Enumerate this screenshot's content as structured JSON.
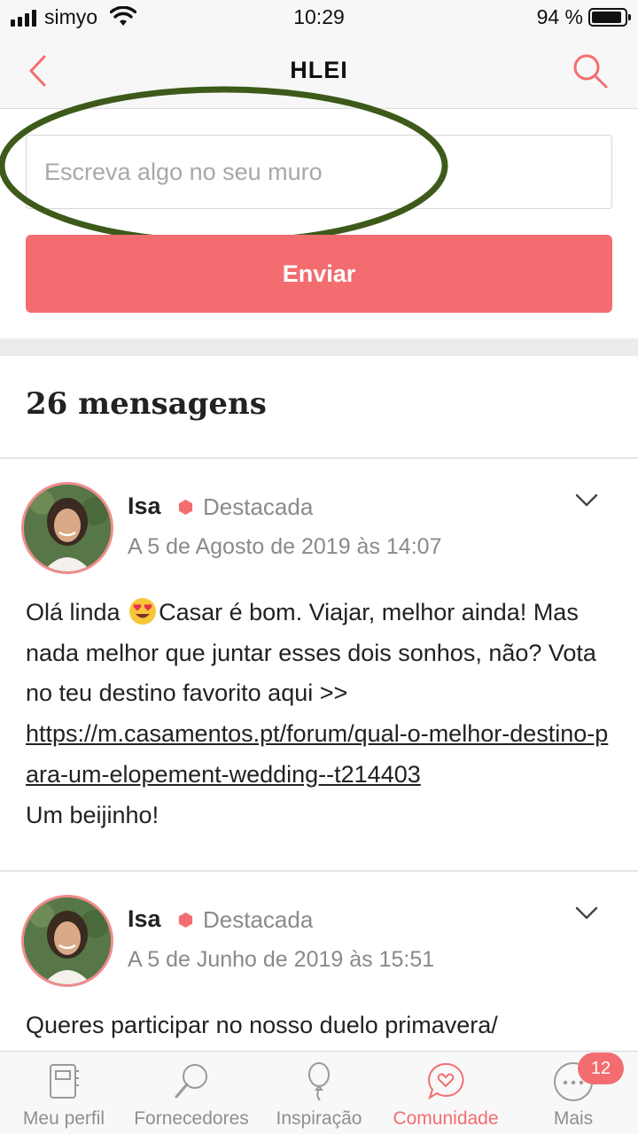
{
  "status_bar": {
    "carrier": "simyo",
    "time": "10:29",
    "battery": "94 %"
  },
  "header": {
    "title": "HLEI",
    "back_icon": "chevron-left-icon",
    "search_icon": "search-icon"
  },
  "composer": {
    "placeholder": "Escreva algo no seu muro",
    "send_label": "Enviar"
  },
  "messages": {
    "count_label": "26 mensagens",
    "posts": [
      {
        "author": "Isa",
        "badge": "Destacada",
        "date": "A 5 de Agosto de 2019 às 14:07",
        "text_before_emoji": "Olá linda",
        "text_after_emoji": "Casar é bom. Viajar, melhor ainda! Mas nada melhor que juntar esses dois sonhos, não? Vota no teu destino favorito aqui >>",
        "link": "https://m.casamentos.pt/forum/qual-o-melhor-destino-para-um-elopement-wedding--t214403",
        "closing": "Um beijinho!"
      },
      {
        "author": "Isa",
        "badge": "Destacada",
        "date": "A 5 de Junho de 2019 às 15:51",
        "text": "Queres participar no nosso duelo primavera/"
      }
    ]
  },
  "tab_bar": {
    "items": [
      {
        "label": "Meu perfil",
        "icon": "notebook-icon"
      },
      {
        "label": "Fornecedores",
        "icon": "magnifier-icon"
      },
      {
        "label": "Inspiração",
        "icon": "balloon-icon"
      },
      {
        "label": "Comunidade",
        "icon": "chat-heart-icon",
        "active": true
      },
      {
        "label": "Mais",
        "icon": "more-dots-icon"
      }
    ],
    "more_badge": "12"
  },
  "colors": {
    "accent": "#f36d70",
    "highlight_ellipse": "#3d5a1a"
  }
}
